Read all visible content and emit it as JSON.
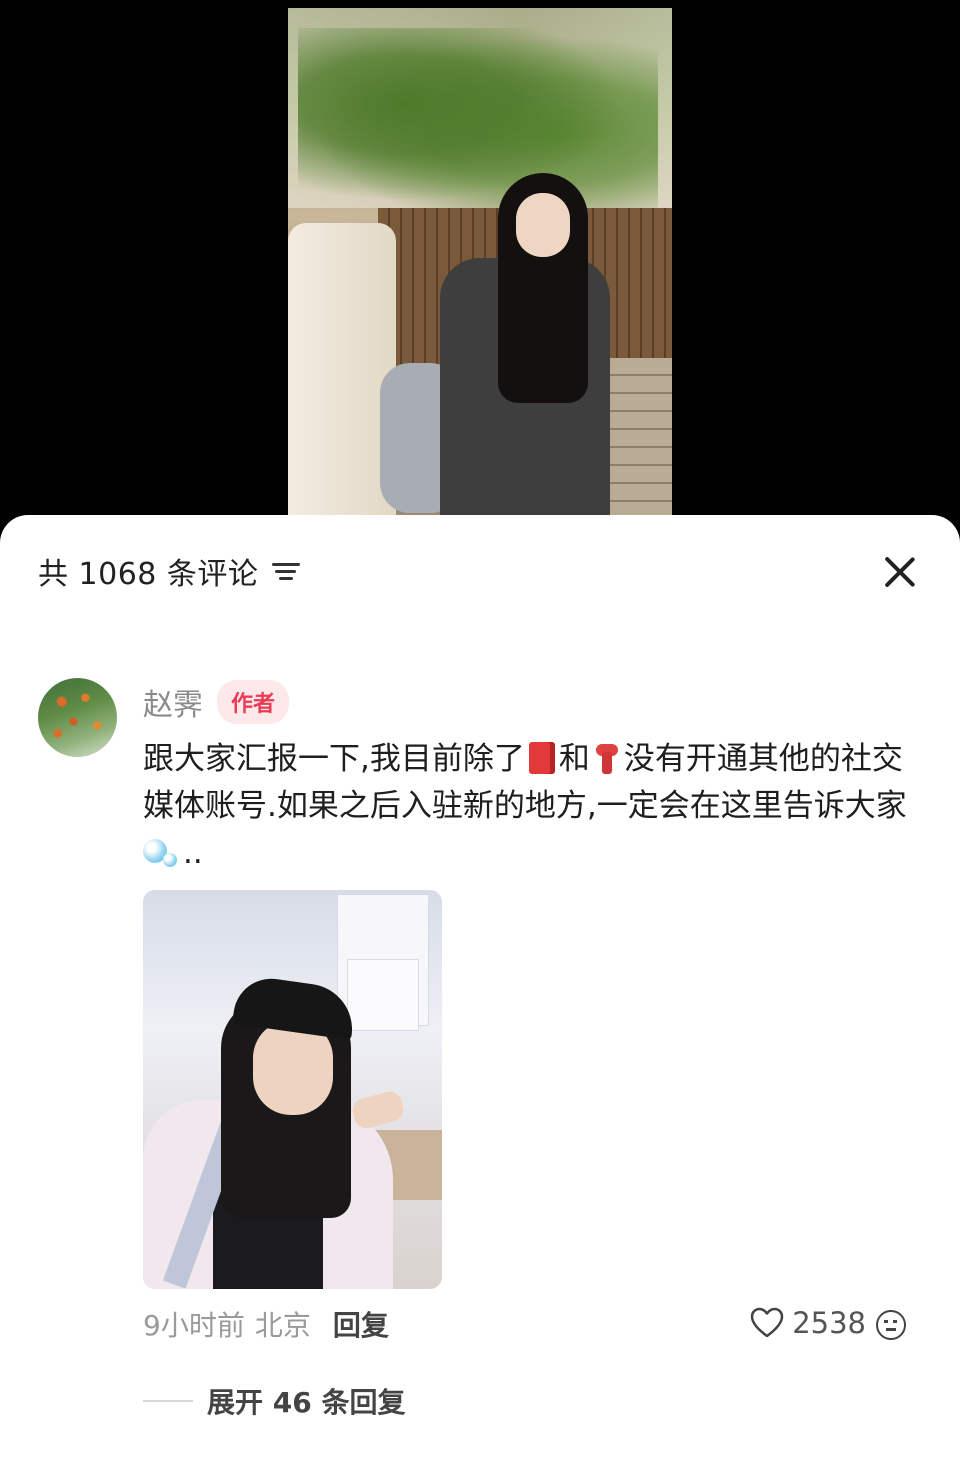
{
  "video": {
    "frame_description_icon": "video-frame"
  },
  "comments_panel": {
    "count_label": "共 1068 条评论",
    "sort_icon": "sort-filter-icon",
    "close_icon": "close-icon"
  },
  "comment": {
    "author": "赵霁",
    "author_badge": "作者",
    "text_part1": "跟大家汇报一下,我目前除了",
    "text_part2": "和",
    "text_part3": "没有开通其他的社交媒体账号.如果之后入驻新的地方,一定会在这里告诉大家",
    "text_part4": "..",
    "emoji_1": "red-book-icon",
    "emoji_2": "scarf-icon",
    "emoji_3": "bubbles-icon",
    "time": "9小时前",
    "location": "北京",
    "reply_label": "回复",
    "like_count": "2538",
    "expand_label": "展开 46 条回复"
  },
  "colors": {
    "badge_text": "#ec3b56",
    "badge_bg": "#fde8ea"
  }
}
